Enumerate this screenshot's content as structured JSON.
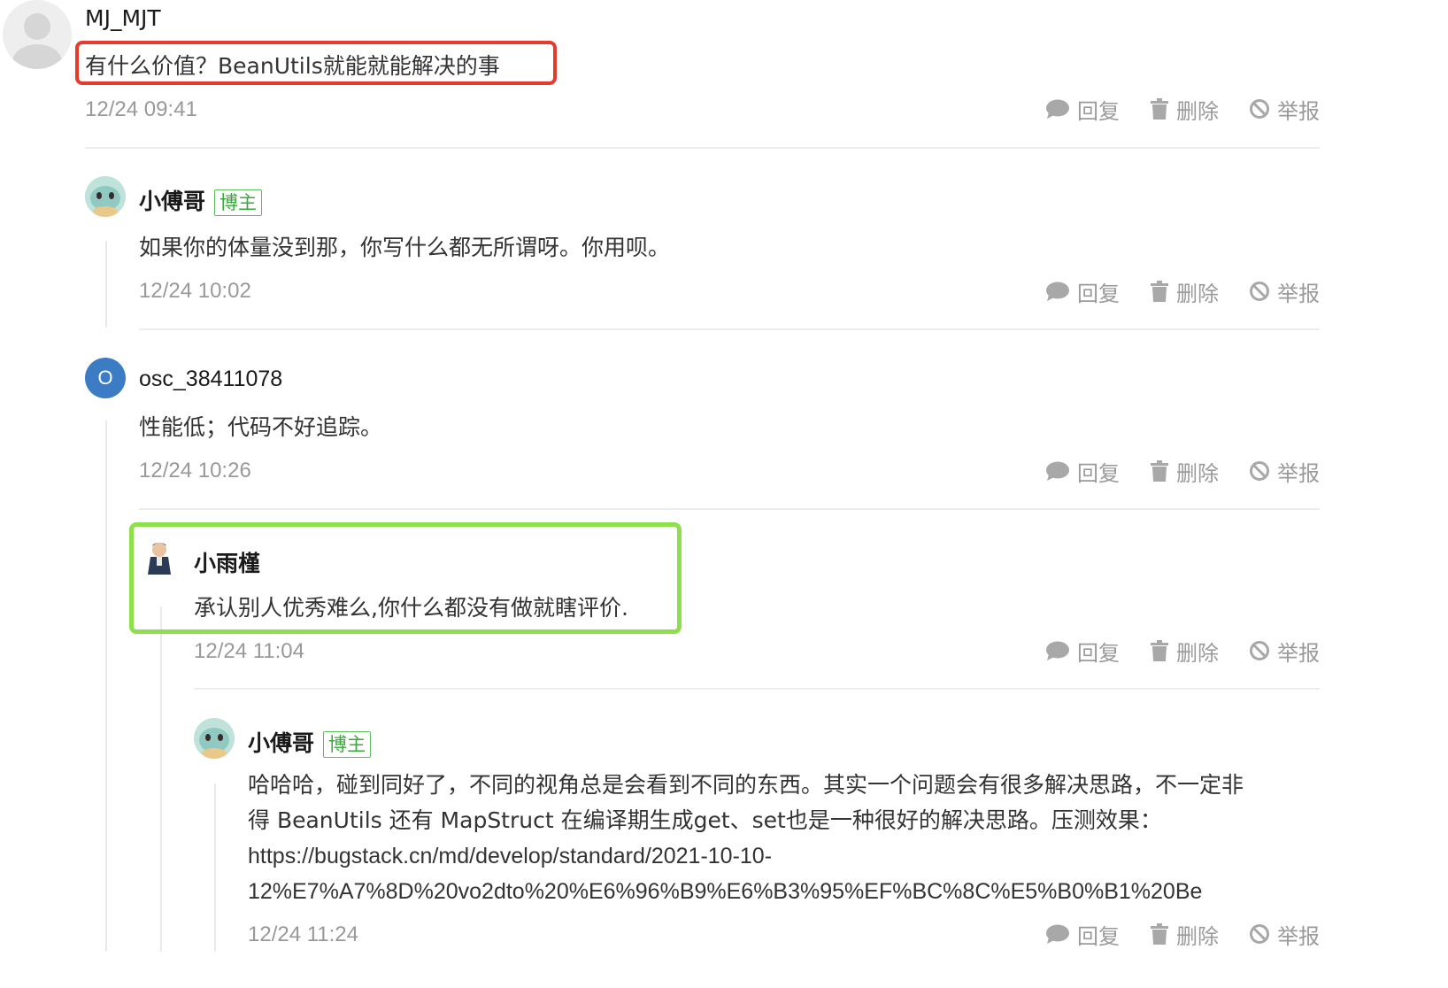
{
  "actions": {
    "reply": "回复",
    "delete": "删除",
    "report": "举报"
  },
  "badge_label": "博主",
  "avatar_initial": "O",
  "colors": {
    "highlight_red": "#e53b2c",
    "highlight_green": "#8ee04a",
    "badge_green": "#3aa83a",
    "avatar_blue": "#3b7cc4"
  },
  "comments": [
    {
      "author": "MJ_MJT",
      "content": "有什么价值？BeanUtils就能就能解决的事",
      "time": "12/24 09:41"
    },
    {
      "author": "小傅哥",
      "content": "如果你的体量没到那，你写什么都无所谓呀。你用呗。",
      "time": "12/24 10:02"
    },
    {
      "author": "osc_38411078",
      "content": "性能低；代码不好追踪。",
      "time": "12/24 10:26"
    },
    {
      "author": "小雨槿",
      "content": "承认别人优秀难么,你什么都没有做就瞎评价.",
      "time": "12/24 11:04"
    },
    {
      "author": "小傅哥",
      "content_lines": [
        "哈哈哈，碰到同好了，不同的视角总是会看到不同的东西。其实一个问题会有很多解决思路，不一定非",
        "得 BeanUtils 还有 MapStruct 在编译期生成get、set也是一种很好的解决思路。压测效果：",
        "https://bugstack.cn/md/develop/standard/2021-10-10-",
        "12%E7%A7%8D%20vo2dto%20%E6%96%B9%E6%B3%95%EF%BC%8C%E5%B0%B1%20Be"
      ],
      "time": "12/24 11:24"
    }
  ]
}
